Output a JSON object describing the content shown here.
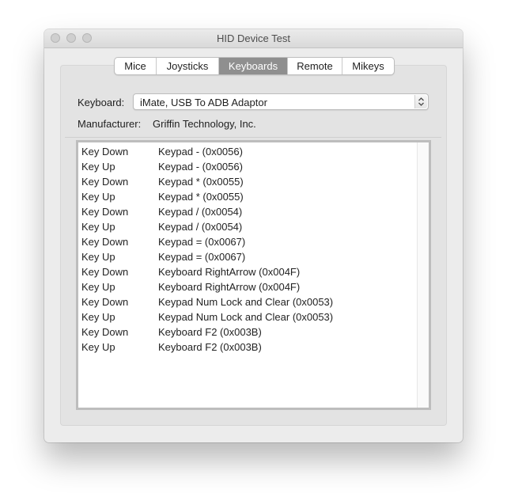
{
  "window": {
    "title": "HID Device Test"
  },
  "tabs": [
    {
      "label": "Mice",
      "selected": false
    },
    {
      "label": "Joysticks",
      "selected": false
    },
    {
      "label": "Keyboards",
      "selected": true
    },
    {
      "label": "Remote",
      "selected": false
    },
    {
      "label": "Mikeys",
      "selected": false
    }
  ],
  "keyboard": {
    "label": "Keyboard:",
    "selected": "iMate, USB To ADB Adaptor"
  },
  "manufacturer": {
    "label": "Manufacturer:",
    "value": "Griffin Technology, Inc."
  },
  "log": {
    "rows": [
      {
        "event": "Key Down",
        "key": "Keypad - (0x0056)"
      },
      {
        "event": "Key Up",
        "key": "Keypad - (0x0056)"
      },
      {
        "event": "Key Down",
        "key": "Keypad * (0x0055)"
      },
      {
        "event": "Key Up",
        "key": "Keypad * (0x0055)"
      },
      {
        "event": "Key Down",
        "key": "Keypad / (0x0054)"
      },
      {
        "event": "Key Up",
        "key": "Keypad / (0x0054)"
      },
      {
        "event": "Key Down",
        "key": "Keypad = (0x0067)"
      },
      {
        "event": "Key Up",
        "key": "Keypad = (0x0067)"
      },
      {
        "event": "Key Down",
        "key": "Keyboard RightArrow (0x004F)"
      },
      {
        "event": "Key Up",
        "key": "Keyboard RightArrow (0x004F)"
      },
      {
        "event": "Key Down",
        "key": "Keypad Num Lock and Clear (0x0053)"
      },
      {
        "event": "Key Up",
        "key": "Keypad Num Lock and Clear (0x0053)"
      },
      {
        "event": "Key Down",
        "key": "Keyboard F2 (0x003B)"
      },
      {
        "event": "Key Up",
        "key": "Keyboard F2 (0x003B)"
      }
    ]
  },
  "colors": {
    "selected_tab": "#8f8f8f",
    "window_bg": "#ececec"
  }
}
